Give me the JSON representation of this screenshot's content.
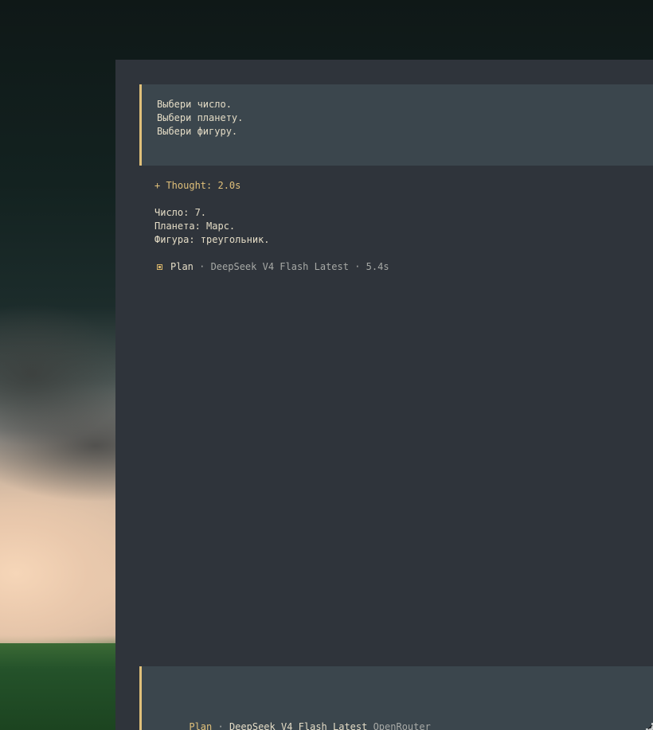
{
  "conversation": {
    "prompt_lines": [
      "Выбери число.",
      "Выбери планету.",
      "Выбери фигуру."
    ],
    "thought_label": "+ Thought: 2.0s",
    "answer_lines": [
      "Число: 7.",
      "Планета: Марс.",
      "Фигура: треугольник."
    ],
    "status": {
      "mode": "Plan",
      "details": " · DeepSeek V4 Flash Latest · 5.4s"
    }
  },
  "input": {
    "mode": "Plan",
    "separator": " · ",
    "model": "DeepSeek V4 Flash Latest",
    "provider": " OpenRouter"
  },
  "colors": {
    "accent": "#e0c07a",
    "panel": "#2f343b",
    "block": "#3b464d",
    "text": "#e4dcc6",
    "muted": "#a7a9a6"
  }
}
